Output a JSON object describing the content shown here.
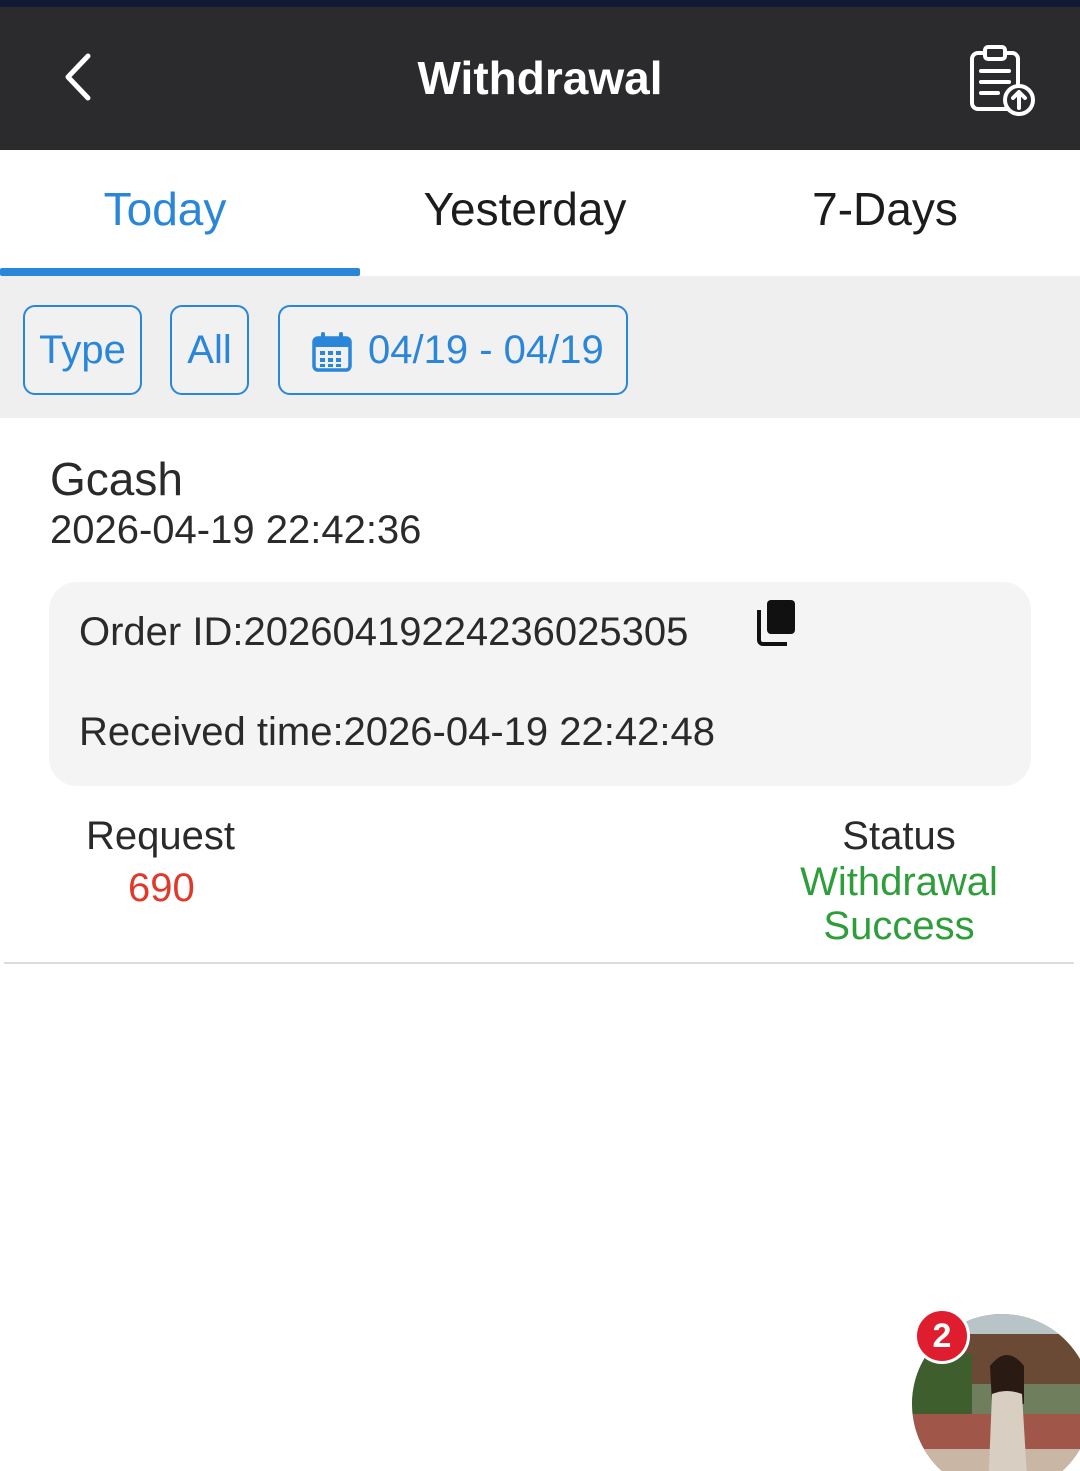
{
  "header": {
    "title": "Withdrawal",
    "back_icon": "chevron-left-icon",
    "records_icon": "clipboard-upload-icon"
  },
  "tabs": [
    {
      "label": "Today",
      "active": true
    },
    {
      "label": "Yesterday",
      "active": false
    },
    {
      "label": "7-Days",
      "active": false
    }
  ],
  "filters": {
    "type_label": "Type",
    "all_label": "All",
    "date_range": "04/19 - 04/19",
    "date_icon": "calendar-icon"
  },
  "record": {
    "method": "Gcash",
    "created_at": "2026-04-19 22:42:36",
    "order_id": "Order ID:20260419224236025305",
    "received_time": "Received time:2026-04-19 22:42:48",
    "request_label": "Request",
    "request_value": "690",
    "status_label": "Status",
    "status_line1": "Withdrawal",
    "status_line2": "Success"
  },
  "float_widget": {
    "badge_count": "2"
  },
  "colors": {
    "header_bg": "#2b2b2d",
    "accent": "#2a86d8",
    "amount": "#e0392b",
    "success": "#2e9e3a"
  }
}
